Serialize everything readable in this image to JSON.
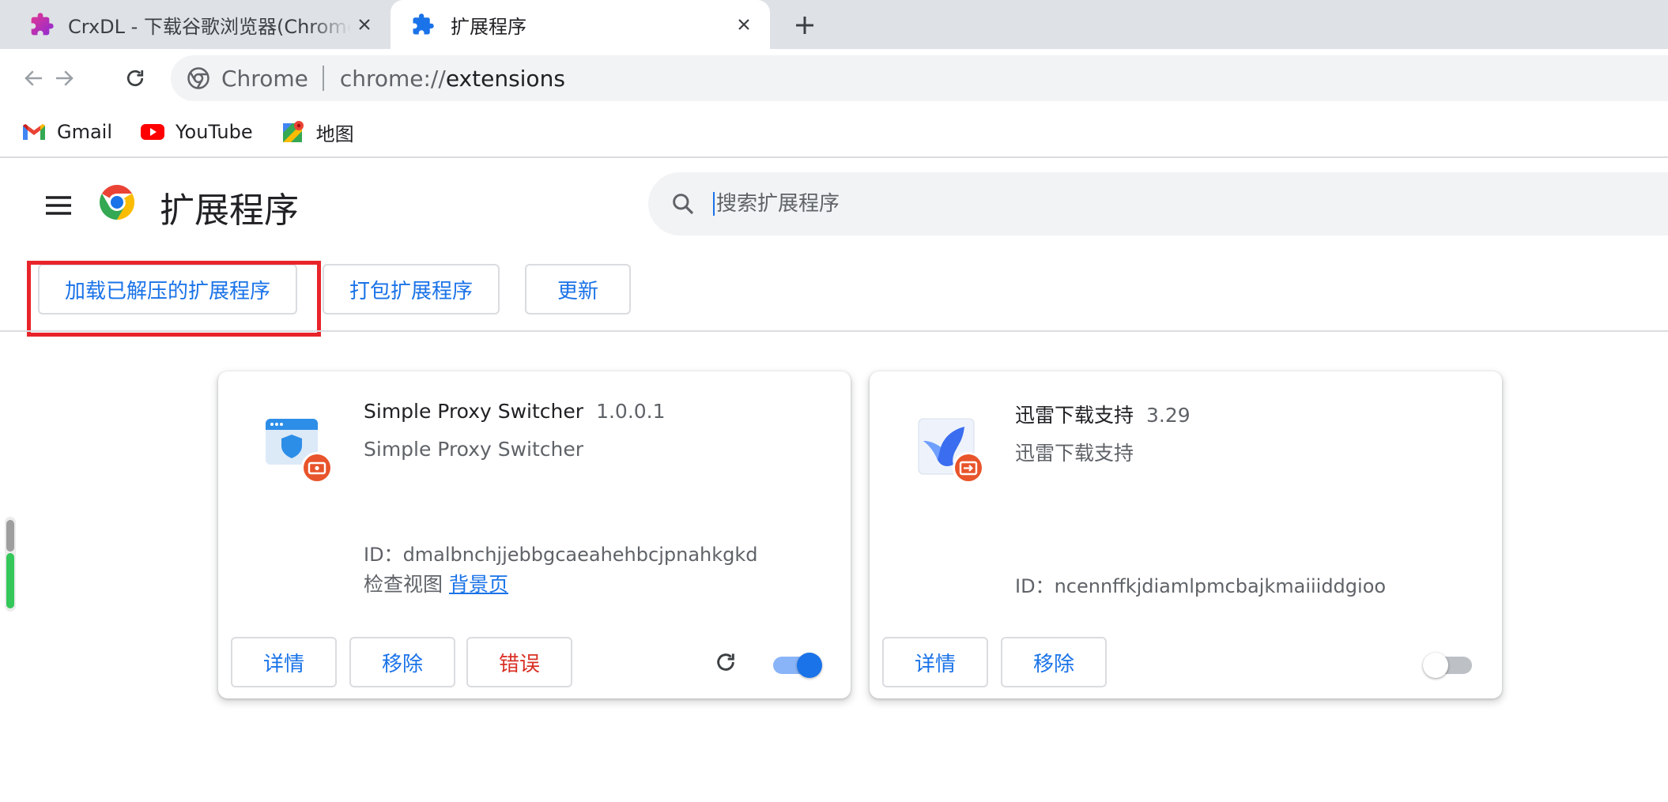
{
  "tabs": [
    {
      "title": "CrxDL - 下载谷歌浏览器(Chrome)",
      "icon": "puzzle-icon",
      "active": false
    },
    {
      "title": "扩展程序",
      "icon": "puzzle-icon",
      "active": true
    }
  ],
  "toolbar": {
    "chip_label": "Chrome",
    "url_scheme": "chrome://",
    "url_host": "extensions"
  },
  "bookmarks": [
    {
      "label": "Gmail",
      "icon": "gmail-icon"
    },
    {
      "label": "YouTube",
      "icon": "youtube-icon"
    },
    {
      "label": "地图",
      "icon": "maps-icon"
    }
  ],
  "header": {
    "title": "扩展程序",
    "search_placeholder": "搜索扩展程序"
  },
  "actions": {
    "load_unpacked": "加载已解压的扩展程序",
    "pack": "打包扩展程序",
    "update": "更新"
  },
  "extensions": [
    {
      "name": "Simple Proxy Switcher",
      "version": "1.0.0.1",
      "description": "Simple Proxy Switcher",
      "id_label": "ID：",
      "id": "dmalbnchjjebbgcaeahehbcjpnahkgkd",
      "views_label": "检查视图",
      "views_link": "背景页",
      "buttons": {
        "details": "详情",
        "remove": "移除",
        "errors": "错误"
      },
      "enabled": true
    },
    {
      "name": "迅雷下载支持",
      "version": "3.29",
      "description": "迅雷下载支持",
      "id_label": "ID：",
      "id": "ncennffkjdiamlpmcbajkmaiiiddgioo",
      "buttons": {
        "details": "详情",
        "remove": "移除"
      },
      "enabled": false
    }
  ],
  "colors": {
    "accent": "#1a73e8",
    "error": "#d93025",
    "highlight": "#e8242b",
    "badge": "#e8542b"
  }
}
